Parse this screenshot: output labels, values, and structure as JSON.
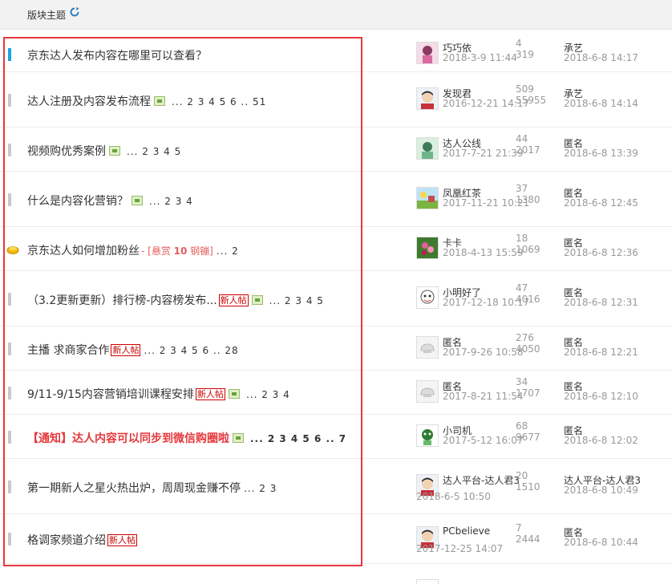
{
  "header": {
    "title": "版块主题",
    "refresh_icon": "refresh-icon"
  },
  "threads": [
    {
      "subject": "京东达人发布内容在哪里可以查看？",
      "mark": "blue",
      "has_image": false,
      "new_post": false,
      "pages": "",
      "author": "巧巧依",
      "author_date": "2018-3-9 11:44",
      "replies": "4",
      "views": "319",
      "last_by": "承艺",
      "last_date": "2018-6-8 14:17",
      "avatar": "pink"
    },
    {
      "subject": "达人注册及内容发布流程",
      "mark": "gray",
      "has_image": true,
      "new_post": false,
      "pages": "... 2 3 4 5 6 .. 51",
      "author": "发现君",
      "author_date": "2016-12-21 14:17",
      "replies": "509",
      "views": "55955",
      "last_by": "承艺",
      "last_date": "2018-6-8 14:14",
      "avatar": "face"
    },
    {
      "subject": "视频购优秀案例",
      "mark": "gray",
      "has_image": true,
      "new_post": false,
      "pages": "... 2 3 4 5",
      "author": "达人公线",
      "author_date": "2017-7-21 21:39",
      "replies": "44",
      "views": "2017",
      "last_by": "匿名",
      "last_date": "2018-6-8 13:39",
      "avatar": "green"
    },
    {
      "subject": "什么是内容化营销？",
      "mark": "gray",
      "has_image": true,
      "new_post": false,
      "pages": "... 2 3 4",
      "author": "凤凰红茶",
      "author_date": "2017-11-21 10:21",
      "replies": "37",
      "views": "1380",
      "last_by": "匿名",
      "last_date": "2018-6-8 12:45",
      "avatar": "landscape"
    },
    {
      "subject": "京东达人如何增加粉丝",
      "mark": "coin",
      "has_image": false,
      "new_post": false,
      "pages": "... 2",
      "reward_prefix": "- [悬赏",
      "reward_amount": "10",
      "reward_suffix": "钢镚]",
      "author": "卡卡",
      "author_date": "2018-4-13 15:59",
      "replies": "18",
      "views": "1069",
      "last_by": "匿名",
      "last_date": "2018-6-8 12:36",
      "avatar": "flower"
    },
    {
      "subject": "（3.2更新更新）排行榜-内容榜发布...",
      "mark": "gray",
      "has_image": true,
      "new_post": true,
      "pages": "... 2 3 4 5",
      "author": "小明好了",
      "author_date": "2017-12-18 10:17",
      "replies": "47",
      "views": "4016",
      "last_by": "匿名",
      "last_date": "2018-6-8 12:31",
      "avatar": "cartoon"
    },
    {
      "subject": "主播 求商家合作",
      "mark": "gray",
      "has_image": false,
      "new_post": true,
      "pages": "... 2 3 4 5 6 .. 28",
      "author": "匿名",
      "author_date": "2017-9-26 10:58",
      "replies": "276",
      "views": "4050",
      "last_by": "匿名",
      "last_date": "2018-6-8 12:21",
      "avatar": "anon"
    },
    {
      "subject": "9/11-9/15内容营销培训课程安排",
      "mark": "gray",
      "has_image": true,
      "new_post": true,
      "pages": "... 2 3 4",
      "author": "匿名",
      "author_date": "2017-8-21 11:54",
      "replies": "34",
      "views": "1707",
      "last_by": "匿名",
      "last_date": "2018-6-8 12:10",
      "avatar": "anon"
    },
    {
      "subject": "【通知】达人内容可以同步到微信购圈啦",
      "mark": "gray",
      "red": true,
      "has_image": true,
      "new_post": false,
      "pages": "... 2 3 4 5 6 .. 7",
      "author": "小司机",
      "author_date": "2017-5-12 16:07",
      "replies": "68",
      "views": "9677",
      "last_by": "匿名",
      "last_date": "2018-6-8 12:02",
      "avatar": "driver"
    },
    {
      "subject": "第一期新人之星火热出炉，周周现金赚不停",
      "mark": "gray",
      "has_image": false,
      "new_post": false,
      "pages": "... 2 3",
      "author": "达人平台-达人君3",
      "author_date": "2018-6-5 10:50",
      "replies": "20",
      "views": "1510",
      "last_by": "达人平台-达人君3",
      "last_date": "2018-6-8 10:49",
      "avatar": "face"
    },
    {
      "subject": "格调家频道介绍",
      "mark": "gray",
      "has_image": false,
      "new_post": true,
      "pages": "",
      "author": "PCbelieve",
      "author_date": "2017-12-25 14:07",
      "replies": "7",
      "views": "2444",
      "last_by": "匿名",
      "last_date": "2018-6-8 10:44",
      "avatar": "face"
    }
  ],
  "labels": {
    "new_post": "新人帖"
  }
}
